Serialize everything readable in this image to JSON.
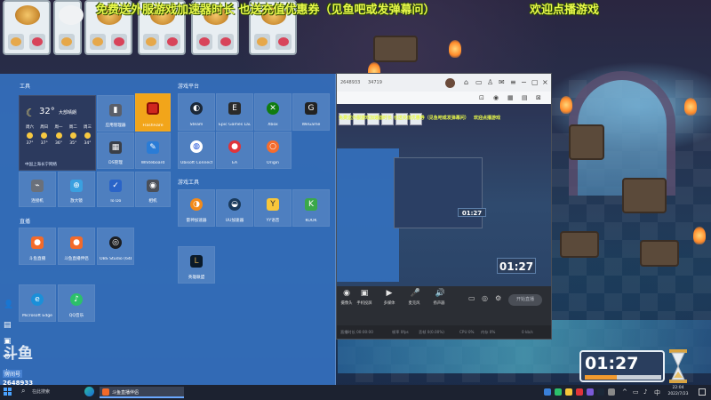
{
  "overlay": {
    "promo_text": "免费送外服游戏加速器时长 也送充值优惠券（见鱼吧或发弹幕问）",
    "welcome_text": "欢迎点播游戏"
  },
  "start_menu": {
    "group_work": "工具",
    "group_games": "游戏平台",
    "group_live": "直播",
    "group_tools2": "游戏工具",
    "weather": {
      "temp": "32",
      "unit": "°",
      "condition": "大部晴朗",
      "location": "中国上海长宁网络",
      "days": [
        "周六",
        "周日",
        "周一",
        "周二",
        "周三"
      ],
      "highs": [
        "37°",
        "37°",
        "36°",
        "35°",
        "34°"
      ]
    },
    "tiles": {
      "app_mgr": "应用管理器",
      "flashfiare": "FlashFiare",
      "steam": "Steam",
      "epic": "Epic Games Launcher",
      "xbox": "Xbox",
      "wegame": "WeGame",
      "ds": "DS管理",
      "whiteboard": "Whiteboard",
      "ubisoft": "Ubisoft Connect",
      "ea": "EA",
      "origin": "Origin",
      "usb": "连接机",
      "magnifier": "放大镜",
      "todo": "To Do",
      "camera": "相机",
      "tool_a": "雷神加速器",
      "uu": "UU加速器",
      "yy": "YY语音",
      "kook": "KOOK",
      "live_a": "斗鱼直播",
      "live_b": "斗鱼直播伴侣",
      "obs": "OBS Studio (64bit)",
      "lol": "英雄联盟",
      "edge": "Microsoft Edge",
      "qq": "QQ音乐"
    }
  },
  "stream_window": {
    "room_id": "2648933",
    "fans": "34719",
    "preview_promo": "免费送外服游戏加速器时长 也送充值优惠券（见鱼吧或发弹幕问）",
    "preview_welcome": "欢迎点播游戏",
    "preview_timer": "01:27",
    "nested_timer": "01:27",
    "controls": [
      {
        "icon": "◉",
        "label": "摄像头"
      },
      {
        "icon": "▣",
        "label": "手机投屏"
      },
      {
        "icon": "▶",
        "label": "多媒体"
      },
      {
        "icon": "🎤",
        "label": "麦克风"
      },
      {
        "icon": "🔊",
        "label": "扬声器"
      }
    ],
    "start_live": "开始直播",
    "status": [
      "直播时长 00:00:00",
      "帧率 0fps",
      "丢帧 0(0.00%)",
      "CPU 0%",
      "内存 0%",
      "0 kb/s"
    ]
  },
  "timer": {
    "value": "01:27",
    "progress": 0.42
  },
  "douyu": {
    "logo": "斗鱼",
    "sub": "房间号",
    "room": "2648933"
  },
  "taskbar": {
    "search_label": "在此搜索",
    "active_app": "斗鱼直播伴侣",
    "time": "22:04",
    "date": "2022/7/23"
  },
  "colors": {
    "overlay_yellow": "#e8f84a",
    "start_blue": "#3470be",
    "timer_orange": "#f29a2e"
  }
}
